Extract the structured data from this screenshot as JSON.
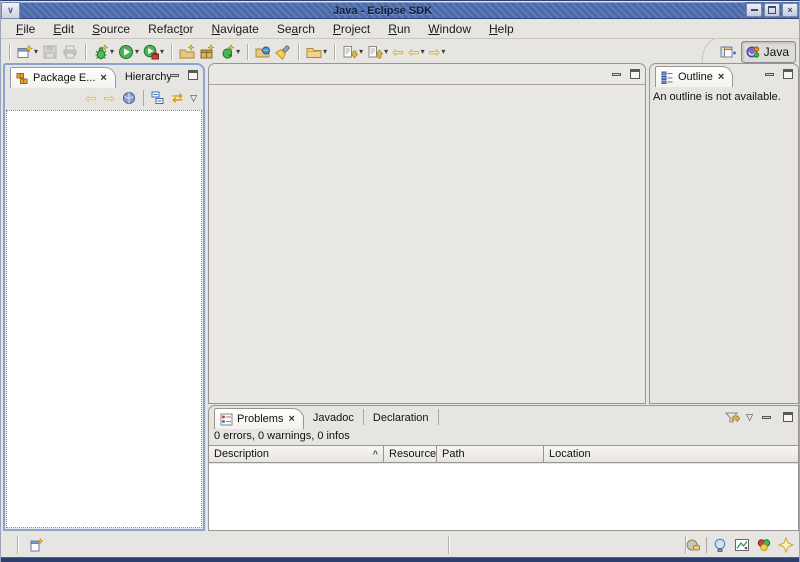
{
  "window": {
    "title": "Java - Eclipse SDK"
  },
  "glyphs": {
    "window_menu": "∨",
    "close": "×",
    "caret": "▾",
    "view_menu": "▽",
    "back": "⇦",
    "forward": "⇨",
    "play": "▶",
    "link_with_editor": "⇄",
    "sort_asc": "^"
  },
  "menubar": {
    "items": [
      {
        "pre": "",
        "key": "F",
        "post": "ile"
      },
      {
        "pre": "",
        "key": "E",
        "post": "dit"
      },
      {
        "pre": "",
        "key": "S",
        "post": "ource"
      },
      {
        "pre": "Refac",
        "key": "t",
        "post": "or"
      },
      {
        "pre": "",
        "key": "N",
        "post": "avigate"
      },
      {
        "pre": "Se",
        "key": "a",
        "post": "rch"
      },
      {
        "pre": "",
        "key": "P",
        "post": "roject"
      },
      {
        "pre": "",
        "key": "R",
        "post": "un"
      },
      {
        "pre": "",
        "key": "W",
        "post": "indow"
      },
      {
        "pre": "",
        "key": "H",
        "post": "elp"
      }
    ]
  },
  "perspective": {
    "label": "Java"
  },
  "package_explorer": {
    "tab": "Package E...",
    "hierarchy_tab": "Hierarchy"
  },
  "outline": {
    "tab": "Outline",
    "message": "An outline is not available."
  },
  "problems": {
    "tab": "Problems",
    "javadoc_tab": "Javadoc",
    "declaration_tab": "Declaration",
    "summary": "0 errors, 0 warnings, 0 infos",
    "columns": [
      "Description",
      "Resource",
      "Path",
      "Location"
    ]
  },
  "colors": {
    "titlebar_blue": "#4c6aa6",
    "active_view_border": "#8ba3cf",
    "window_frame": "#2c3e6e"
  }
}
